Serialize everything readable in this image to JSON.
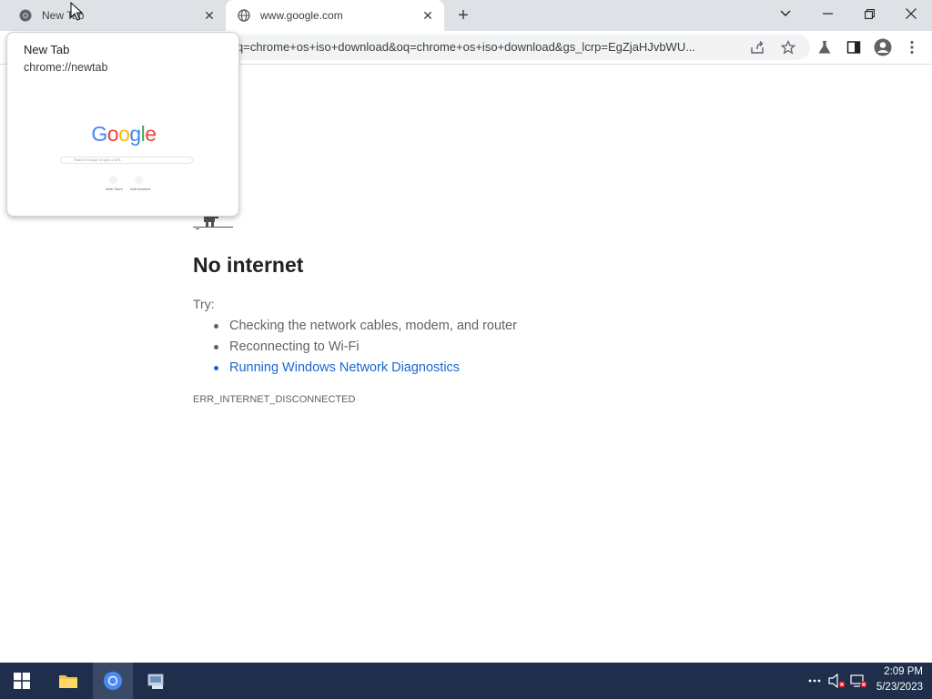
{
  "tabs": [
    {
      "title": "New Tab",
      "active": false,
      "icon": "chrome-icon"
    },
    {
      "title": "www.google.com",
      "active": true,
      "icon": "globe-icon"
    }
  ],
  "toolbar": {
    "url": "q=chrome+os+iso+download&oq=chrome+os+iso+download&gs_lcrp=EgZjaHJvbWU..."
  },
  "hover_card": {
    "title": "New Tab",
    "url": "chrome://newtab",
    "preview": {
      "logo": "Google",
      "search_placeholder": "Search Google or type a URL",
      "shortcuts": [
        "Web Store",
        "Add shortcut"
      ]
    }
  },
  "error_page": {
    "heading": "No internet",
    "try_label": "Try:",
    "suggestions": [
      "Checking the network cables, modem, and router",
      "Reconnecting to Wi-Fi",
      "Running Windows Network Diagnostics"
    ],
    "error_code": "ERR_INTERNET_DISCONNECTED"
  },
  "taskbar": {
    "apps": [
      "start-icon",
      "file-explorer-icon",
      "chrome-icon",
      "network-app-icon"
    ],
    "tray": [
      "overflow-icon",
      "volume-muted-icon",
      "network-disconnected-icon"
    ],
    "time": "2:09 PM",
    "date": "5/23/2023"
  },
  "colors": {
    "tabstrip": "#dee1e6",
    "link": "#1967d2",
    "taskbar": "#1f2e4a"
  }
}
